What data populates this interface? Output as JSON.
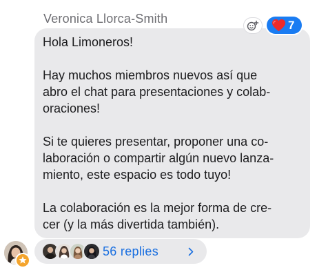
{
  "message": {
    "sender_name": "Veronica Llorca-Smith",
    "paragraphs": [
      "Hola Limoneros!",
      "Hay muchos miembros nuevos así que\nabro el chat para presentaciones y colab-\noraciones!",
      "Si te quieres presentar, proponer una co-\nlaboración o compartir algún nuevo lanza-\nmiento, este espacio es todo tuyo!",
      "La colaboración es la mejor forma de cre-\ncer (y la más divertida también)."
    ]
  },
  "reactions": {
    "add_icon": "add-reaction-icon",
    "items": [
      {
        "emoji_icon": "red-heart-icon",
        "count": "7"
      }
    ]
  },
  "thread": {
    "replies_label": "56 replies",
    "chevron_icon": "chevron-right-icon"
  },
  "author_avatar": {
    "badge_icon": "star-icon"
  },
  "colors": {
    "bubble": "#e9e9eb",
    "accent": "#1a7cf2",
    "link": "#1a6fe0",
    "badge": "#f4a42c"
  }
}
